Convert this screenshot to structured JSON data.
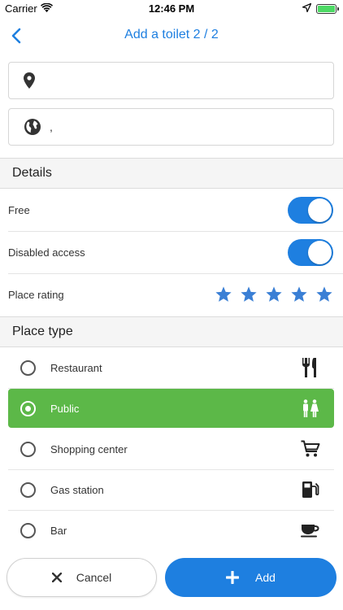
{
  "status_bar": {
    "carrier": "Carrier",
    "time": "12:46 PM"
  },
  "nav": {
    "title": "Add a toilet 2 / 2"
  },
  "address": {
    "street_value": "",
    "country_value": ","
  },
  "details": {
    "header": "Details",
    "free_label": "Free",
    "free_on": true,
    "disabled_label": "Disabled access",
    "disabled_on": true,
    "rating_label": "Place rating",
    "rating_value": 5,
    "rating_max": 5
  },
  "place_type": {
    "header": "Place type",
    "options": [
      {
        "label": "Restaurant",
        "icon": "fork-knife-icon",
        "selected": false
      },
      {
        "label": "Public",
        "icon": "restroom-icon",
        "selected": true
      },
      {
        "label": "Shopping center",
        "icon": "cart-icon",
        "selected": false
      },
      {
        "label": "Gas station",
        "icon": "gas-pump-icon",
        "selected": false
      },
      {
        "label": "Bar",
        "icon": "coffee-cup-icon",
        "selected": false
      }
    ]
  },
  "actions": {
    "cancel_label": "Cancel",
    "add_label": "Add"
  },
  "colors": {
    "accent": "#1e7fe0",
    "selected": "#5cb848"
  }
}
